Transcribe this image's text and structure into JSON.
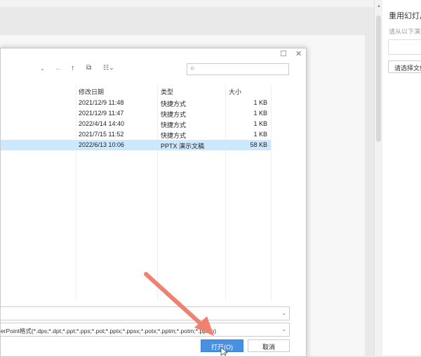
{
  "panel": {
    "title": "重用幻灯片",
    "hint": "请从以下演示",
    "button": "请选择文件"
  },
  "dialog": {
    "columns": {
      "date": "修改日期",
      "type": "类型",
      "size": "大小"
    },
    "rows": [
      {
        "date": "2021/12/9 11:48",
        "type": "快捷方式",
        "size": "1 KB"
      },
      {
        "date": "2021/12/9 11:47",
        "type": "快捷方式",
        "size": "1 KB"
      },
      {
        "date": "2022/4/14 14:40",
        "type": "快捷方式",
        "size": "1 KB"
      },
      {
        "date": "2021/7/15 11:52",
        "type": "快捷方式",
        "size": "1 KB"
      },
      {
        "date": "2022/6/13 10:06",
        "type": "PPTX 演示文稿",
        "size": "58 KB",
        "selected": true
      }
    ],
    "filename": "",
    "filetype": "erPoint格式(*.dps;*.dpt;*.ppt;*.pps;*.pot;*.pptx;*.ppsx;*.potx;*.pptm;*.potm;*.ppsm)",
    "open_label": "打开(O)",
    "cancel_label": "取消"
  },
  "colors": {
    "accent": "#4a90e2",
    "selection": "#cce8ff",
    "arrow": "#f08070"
  }
}
